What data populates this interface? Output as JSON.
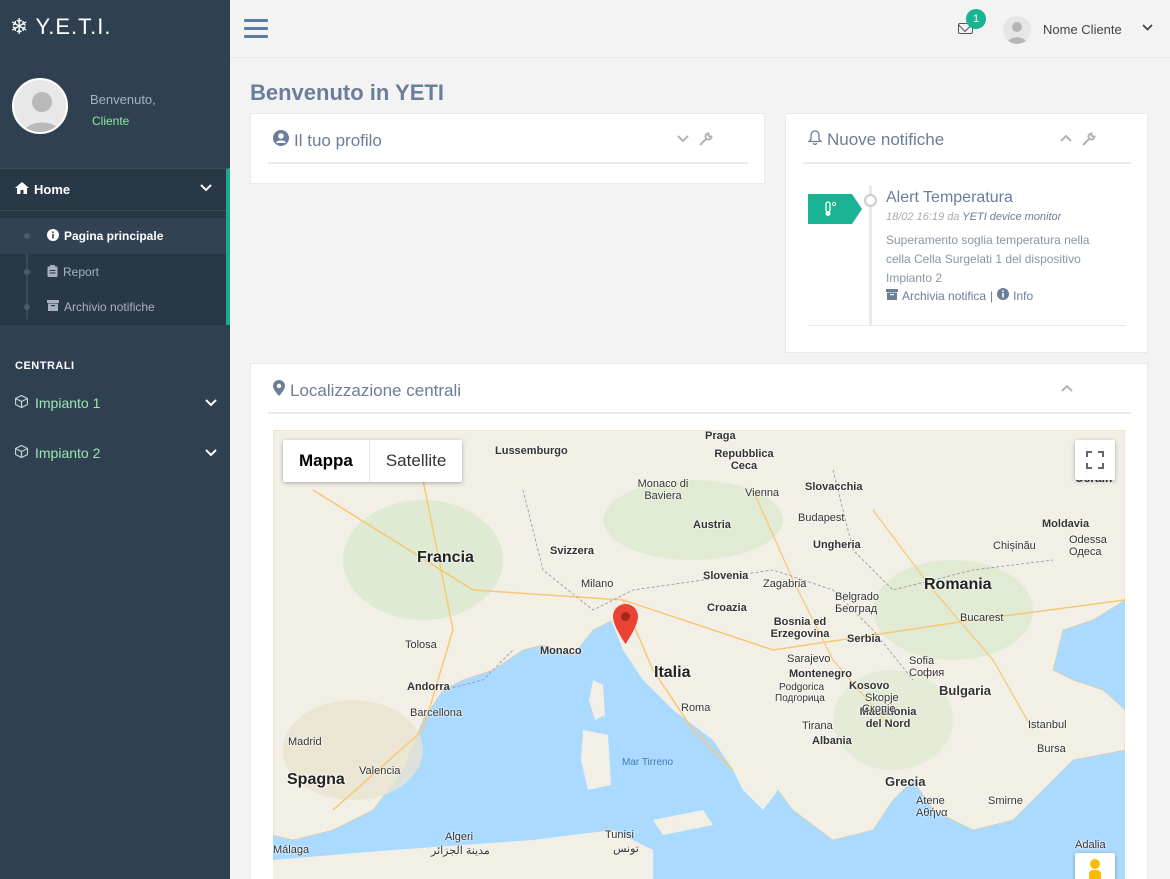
{
  "app": {
    "logo_text": "Y.E.T.I."
  },
  "profile": {
    "welcome": "Benvenuto,",
    "role": "Cliente"
  },
  "nav": {
    "home_label": "Home",
    "sub_items": [
      {
        "label": "Pagina principale"
      },
      {
        "label": "Report"
      },
      {
        "label": "Archivio notifiche"
      }
    ],
    "section_label": "CENTRALI",
    "plants": [
      {
        "label": "Impianto 1"
      },
      {
        "label": "Impianto 2"
      }
    ]
  },
  "topbar": {
    "notification_count": "1",
    "user_name": "Nome Cliente"
  },
  "page": {
    "title": "Benvenuto in YETI"
  },
  "profile_box": {
    "title": "Il tuo profilo"
  },
  "notifications_box": {
    "title": "Nuove notifiche",
    "items": [
      {
        "title": "Alert Temperatura",
        "timestamp": "18/02 16:19",
        "by": "da",
        "source": "YETI device monitor",
        "description": "Superamento soglia temperatura nella cella Cella Surgelati 1 del dispositivo Impianto 2",
        "archive_label": "Archivia notifica",
        "separator": "|",
        "info_label": "Info"
      }
    ]
  },
  "map_box": {
    "title": "Localizzazione centrali",
    "map_type_options": [
      "Mappa",
      "Satellite"
    ],
    "selected_map_type": "Mappa",
    "labels": {
      "countries": [
        "Francia",
        "Italia",
        "Spagna",
        "Romania",
        "Bulgaria",
        "Grecia",
        "Ucrain",
        "Austria",
        "Svizzera",
        "Slovacchia",
        "Ungheria",
        "Slovenia",
        "Croazia",
        "Serbia",
        "Bosnia ed Erzegovina",
        "Montenegro",
        "Kosovo",
        "Albania",
        "Macedonia del Nord",
        "Moldavia",
        "Andorra",
        "Monaco"
      ],
      "cities": [
        "Lussemburgo",
        "Praga",
        "Repubblica Ceca",
        "Monaco di Baviera",
        "Vienna",
        "Budapest",
        "Milano",
        "Zagabria",
        "Belgrado",
        "Београд",
        "Bucarest",
        "Chișinău",
        "Odessa",
        "Одеса",
        "Sarajevo",
        "Sofia",
        "София",
        "Podgorica",
        "Подгорица",
        "Skopje",
        "Скопје",
        "Tirana",
        "Tolosa",
        "Barcellona",
        "Roma",
        "Madrid",
        "Valencia",
        "Istanbul",
        "Bursa",
        "Smirne",
        "Atene",
        "Αθήνα",
        "Algeri",
        "مدينة الجزائر",
        "Tunisi",
        "تونس",
        "Málaga",
        "Adalia"
      ],
      "seas": [
        "Mar Tirreno"
      ]
    },
    "marker": {
      "icon": "map-pin-icon",
      "color": "#d93025"
    }
  },
  "colors": {
    "sidebar": "#2f4050",
    "accent": "#1ab394",
    "title": "#6a7e99"
  }
}
